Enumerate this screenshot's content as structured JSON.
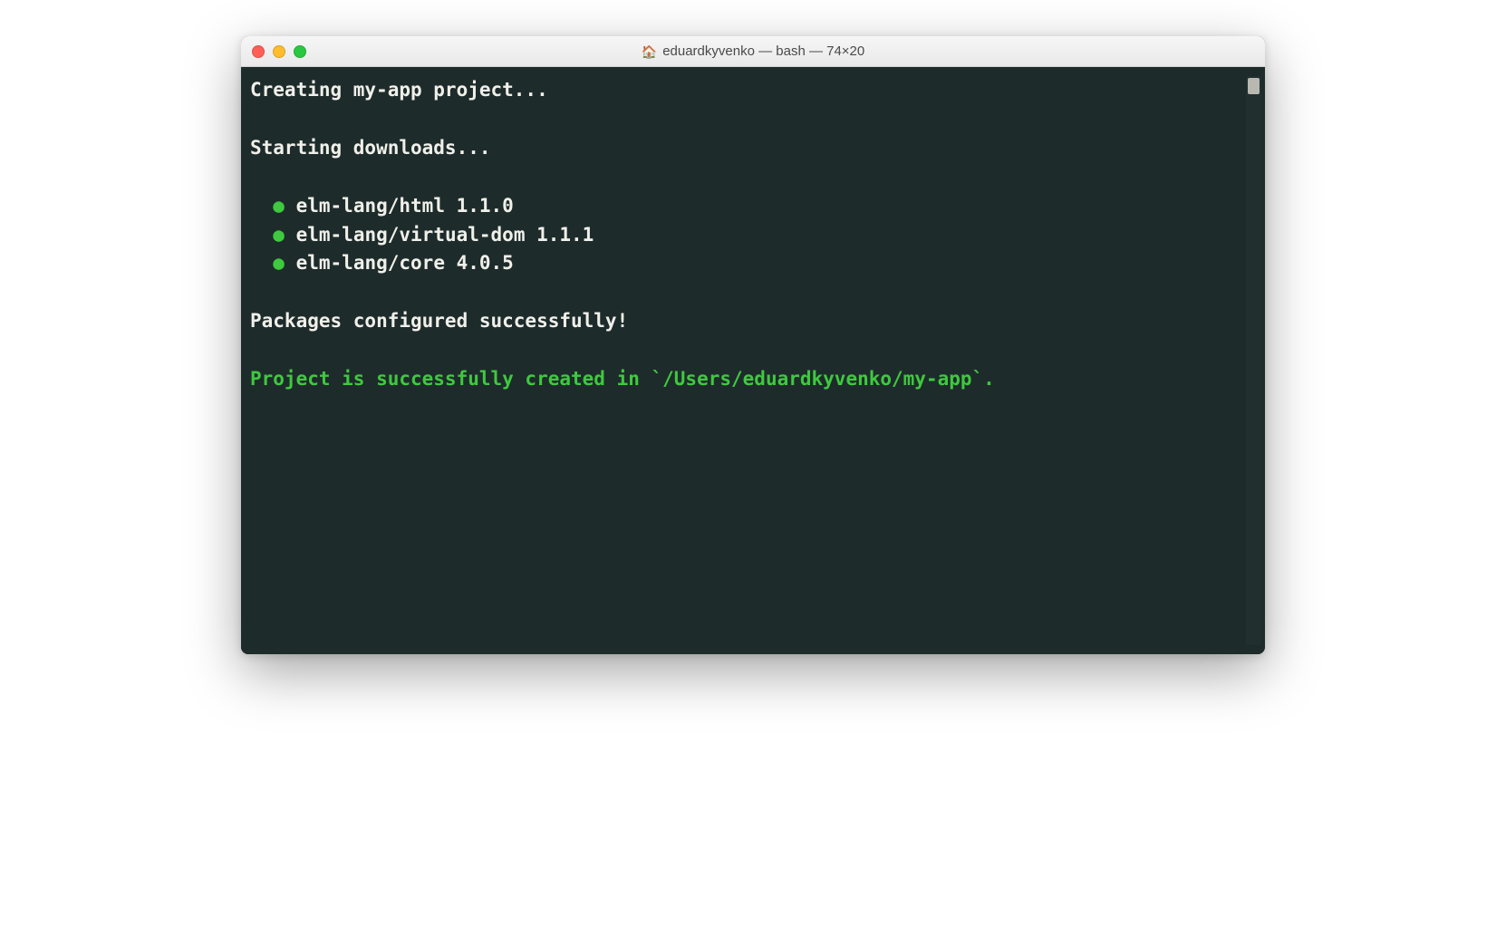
{
  "window": {
    "title": "eduardkyvenko — bash — 74×20",
    "home_icon": "🏠"
  },
  "terminal": {
    "line_creating": "Creating my-app project...",
    "line_starting": "Starting downloads...",
    "packages": [
      {
        "bullet": "●",
        "name": "elm-lang/html 1.1.0"
      },
      {
        "bullet": "●",
        "name": "elm-lang/virtual-dom 1.1.1"
      },
      {
        "bullet": "●",
        "name": "elm-lang/core 4.0.5"
      }
    ],
    "line_configured": "Packages configured successfully!",
    "line_success": "Project is successfully created in `/Users/eduardkyvenko/my-app`."
  }
}
